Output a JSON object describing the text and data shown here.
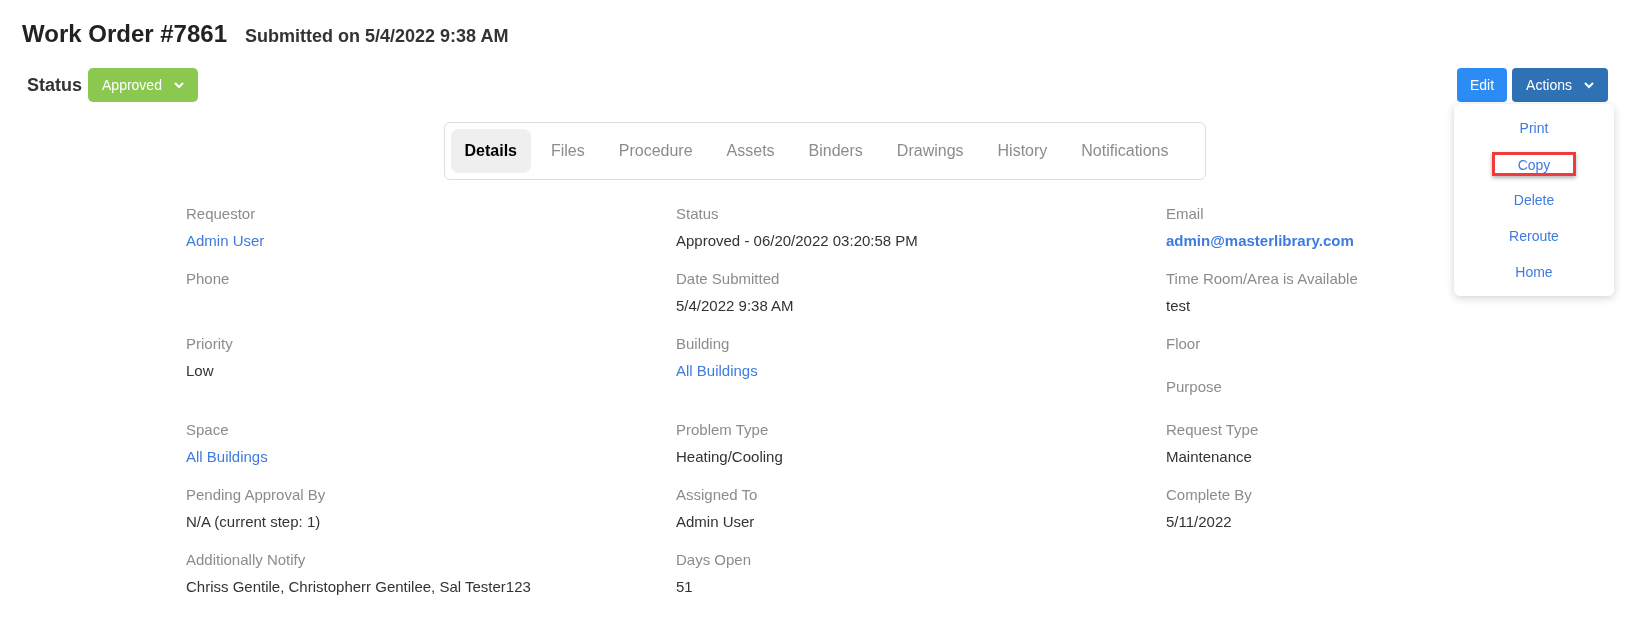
{
  "header": {
    "title": "Work Order #7861",
    "submitted": "Submitted on 5/4/2022 9:38 AM"
  },
  "status": {
    "label": "Status",
    "value": "Approved"
  },
  "buttons": {
    "edit": "Edit",
    "actions": "Actions"
  },
  "actions_menu": [
    {
      "label": "Print",
      "highlighted": false
    },
    {
      "label": "Copy",
      "highlighted": true
    },
    {
      "label": "Delete",
      "highlighted": false
    },
    {
      "label": "Reroute",
      "highlighted": false
    },
    {
      "label": "Home",
      "highlighted": false
    }
  ],
  "tabs": [
    {
      "label": "Details",
      "selected": true
    },
    {
      "label": "Files",
      "selected": false
    },
    {
      "label": "Procedure",
      "selected": false
    },
    {
      "label": "Assets",
      "selected": false
    },
    {
      "label": "Binders",
      "selected": false
    },
    {
      "label": "Drawings",
      "selected": false
    },
    {
      "label": "History",
      "selected": false
    },
    {
      "label": "Notifications",
      "selected": false
    }
  ],
  "rows": [
    [
      [
        {
          "label": "Requestor",
          "value": "Admin User",
          "kind": "link"
        }
      ],
      [
        {
          "label": "Status",
          "value": "Approved - 06/20/2022 03:20:58 PM",
          "kind": "text"
        }
      ],
      [
        {
          "label": "Email",
          "value": "admin@masterlibrary.com",
          "kind": "email"
        }
      ]
    ],
    [
      [
        {
          "label": "Phone"
        }
      ],
      [
        {
          "label": "Date Submitted",
          "value": "5/4/2022 9:38 AM",
          "kind": "text"
        }
      ],
      [
        {
          "label": "Time Room/Area is Available",
          "value": "test",
          "kind": "text"
        }
      ]
    ],
    [
      [
        {
          "label": "Priority",
          "value": "Low",
          "kind": "text"
        }
      ],
      [
        {
          "label": "Building",
          "value": "All Buildings",
          "kind": "link"
        }
      ],
      [
        {
          "label": "Floor"
        },
        {
          "label": "Purpose"
        }
      ]
    ],
    [
      [
        {
          "label": "Space",
          "value": "All Buildings",
          "kind": "link"
        }
      ],
      [
        {
          "label": "Problem Type",
          "value": "Heating/Cooling",
          "kind": "text"
        }
      ],
      [
        {
          "label": "Request Type",
          "value": "Maintenance",
          "kind": "text"
        }
      ]
    ],
    [
      [
        {
          "label": "Pending Approval By",
          "value": "N/A (current step: 1)",
          "kind": "text"
        }
      ],
      [
        {
          "label": "Assigned To",
          "value": "Admin User",
          "kind": "text"
        }
      ],
      [
        {
          "label": "Complete By",
          "value": "5/11/2022",
          "kind": "text"
        }
      ]
    ],
    [
      [
        {
          "label": "Additionally Notify",
          "value": "Chriss Gentile, Christopherr Gentilee, Sal Tester123",
          "kind": "text"
        }
      ],
      [
        {
          "label": "Days Open",
          "value": "51",
          "kind": "text"
        }
      ],
      []
    ]
  ]
}
